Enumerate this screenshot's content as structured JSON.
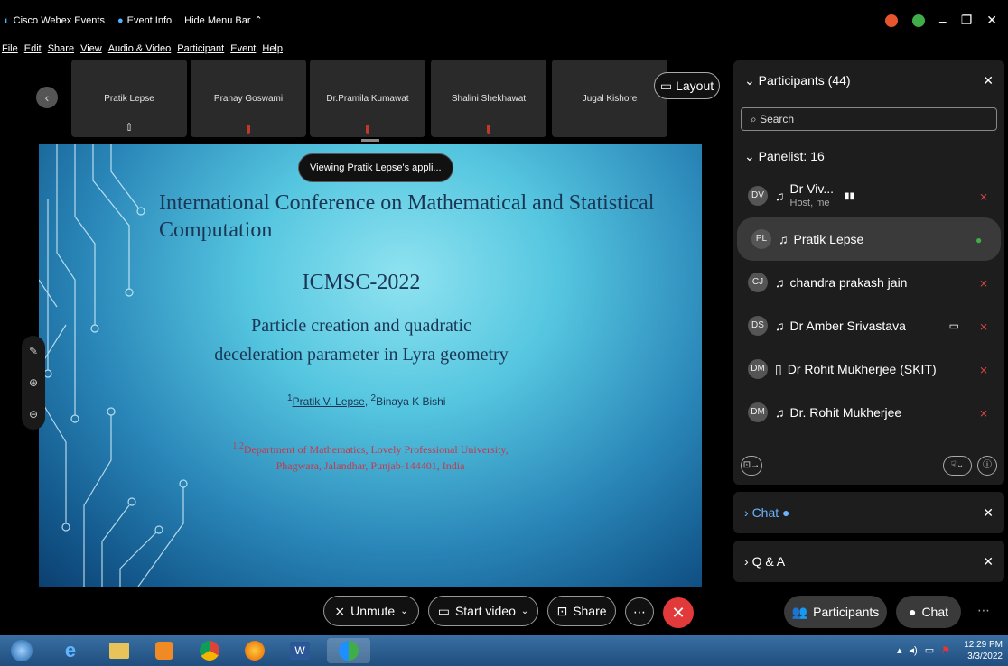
{
  "titlebar": {
    "app": "Cisco Webex Events",
    "event_info": "Event Info",
    "hide_menu": "Hide Menu Bar",
    "menu": [
      "File",
      "Edit",
      "Share",
      "View",
      "Audio & Video",
      "Participant",
      "Event",
      "Help"
    ]
  },
  "strip": {
    "tiles": [
      "Pratik Lepse",
      "Pranay Goswami",
      "Dr.Pramila Kumawat",
      "Shalini Shekhawat",
      "Jugal Kishore"
    ],
    "layout_label": "Layout"
  },
  "slide": {
    "viewing": "Viewing Pratik Lepse's appli...",
    "title_line1": "International Conference on Mathematical and Statistical",
    "title_line2": "Computation",
    "code": "ICMSC-2022",
    "paper_line1": "Particle creation and quadratic",
    "paper_line2": "deceleration parameter in Lyra geometry",
    "author1": "Pratik V. Lepse",
    "author2": "Binaya K Bishi",
    "dept_line1": "Department of Mathematics, Lovely Professional University,",
    "dept_line2": "Phagwara, Jalandhar, Punjab-144401, India",
    "sup12": "1,2",
    "sup1": "1",
    "sup2": "2"
  },
  "panel": {
    "participants_title": "Participants (44)",
    "search_placeholder": "Search",
    "panelist_header": "Panelist: 16",
    "rows": [
      {
        "initials": "DV",
        "name": "Dr Viv...",
        "sub": "Host, me"
      },
      {
        "initials": "PL",
        "name": "Pratik Lepse",
        "sub": ""
      },
      {
        "initials": "CJ",
        "name": "chandra prakash jain",
        "sub": ""
      },
      {
        "initials": "DS",
        "name": "Dr Amber Srivastava",
        "sub": ""
      },
      {
        "initials": "DM",
        "name": "Dr Rohit Mukherjee (SKIT)",
        "sub": ""
      },
      {
        "initials": "DM",
        "name": "Dr. Rohit Mukherjee",
        "sub": ""
      }
    ],
    "chat_label": "Chat",
    "qa_label": "Q & A"
  },
  "controls": {
    "unmute": "Unmute",
    "start_video": "Start video",
    "share": "Share",
    "participants": "Participants",
    "chat": "Chat"
  },
  "taskbar": {
    "time": "12:29 PM",
    "date": "3/3/2022"
  },
  "colors": {
    "accent_blue": "#1f8fff",
    "end_red": "#e23a3a",
    "slide_text": "#1c3554",
    "dept_red": "#c8384a"
  }
}
